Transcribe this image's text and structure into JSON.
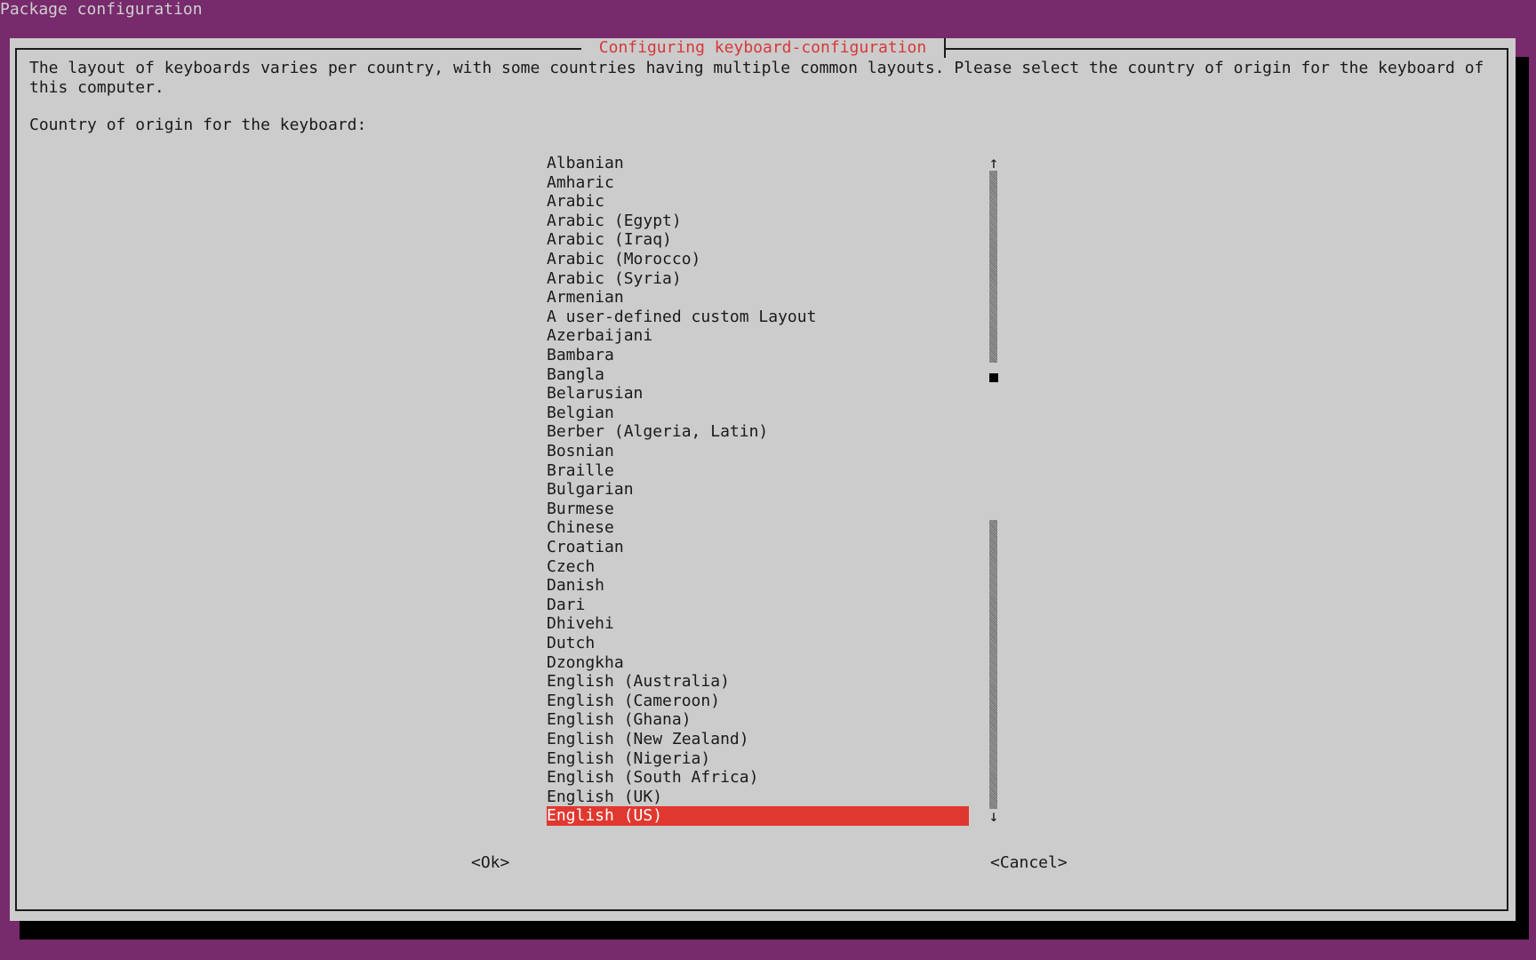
{
  "backtitle": "Package configuration",
  "dialog": {
    "title": "Configuring keyboard-configuration",
    "description": "The layout of keyboards varies per country, with some countries having multiple common layouts. Please select the country of origin for the keyboard of this computer.",
    "prompt": "Country of origin for the keyboard:"
  },
  "list": {
    "items": [
      "Albanian",
      "Amharic",
      "Arabic",
      "Arabic (Egypt)",
      "Arabic (Iraq)",
      "Arabic (Morocco)",
      "Arabic (Syria)",
      "Armenian",
      "A user-defined custom Layout",
      "Azerbaijani",
      "Bambara",
      "Bangla",
      "Belarusian",
      "Belgian",
      "Berber (Algeria, Latin)",
      "Bosnian",
      "Braille",
      "Bulgarian",
      "Burmese",
      "Chinese",
      "Croatian",
      "Czech",
      "Danish",
      "Dari",
      "Dhivehi",
      "Dutch",
      "Dzongkha",
      "English (Australia)",
      "English (Cameroon)",
      "English (Ghana)",
      "English (New Zealand)",
      "English (Nigeria)",
      "English (South Africa)",
      "English (UK)",
      "English (US)"
    ],
    "selected": "English (US)"
  },
  "scrollbar": {
    "up_arrow": "↑",
    "down_arrow": "↓",
    "position_fraction": 0.32
  },
  "buttons": {
    "ok": "<Ok>",
    "cancel": "<Cancel>"
  },
  "colors": {
    "desktop_background": "#772a6c",
    "dialog_background": "#cccccc",
    "title_text": "#d7383a",
    "selection_background": "#e0382f",
    "selection_text": "#ffffff"
  }
}
